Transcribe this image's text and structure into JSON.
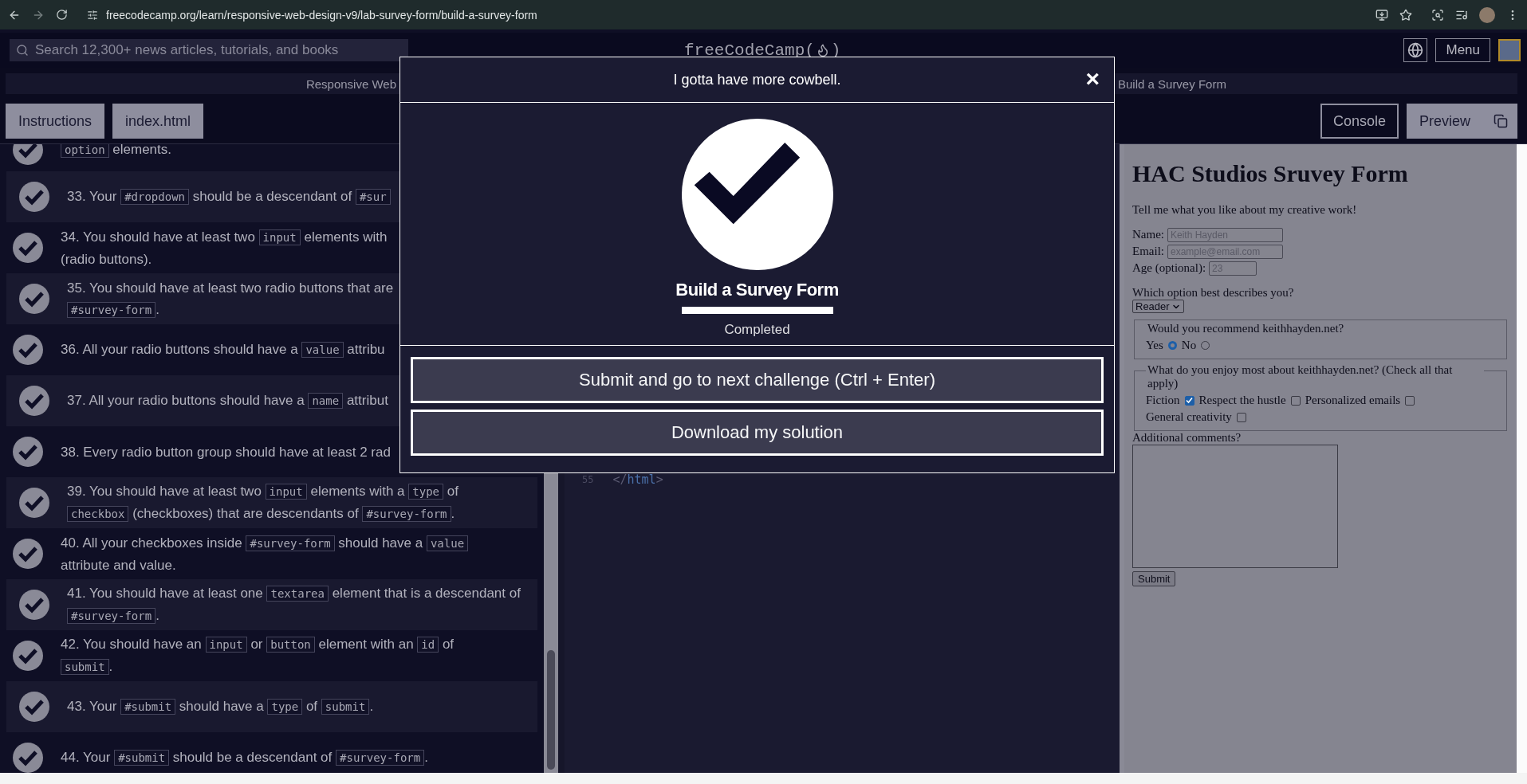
{
  "browser": {
    "url": "freecodecamp.org/learn/responsive-web-design-v9/lab-survey-form/build-a-survey-form"
  },
  "nav": {
    "search_placeholder": "Search 12,300+ news articles, tutorials, and books",
    "logo_before": "freeCodeCamp(",
    "logo_after": ")",
    "menu": "Menu"
  },
  "breadcrumbs": [
    "Responsive Web",
    "Build a Survey Form"
  ],
  "tabs_left": [
    {
      "label": "Instructions",
      "selected": true
    },
    {
      "label": "index.html",
      "selected": true
    }
  ],
  "tabs_right": [
    {
      "label": "Console",
      "selected": false
    },
    {
      "label": "Preview",
      "selected": true
    }
  ],
  "tests": [
    {
      "passed": true,
      "lines": [
        [
          {
            "kind": "code",
            "text": "option"
          },
          {
            "kind": "text",
            "text": " elements."
          }
        ]
      ]
    },
    {
      "passed": true,
      "lines": [
        [
          {
            "kind": "text",
            "text": "33. Your "
          },
          {
            "kind": "code",
            "text": "#dropdown"
          },
          {
            "kind": "text",
            "text": " should be a descendant of "
          },
          {
            "kind": "code",
            "text": "#sur"
          }
        ]
      ]
    },
    {
      "passed": true,
      "lines": [
        [
          {
            "kind": "text",
            "text": "34. You should have at least two "
          },
          {
            "kind": "code",
            "text": "input"
          },
          {
            "kind": "text",
            "text": " elements with"
          }
        ],
        [
          {
            "kind": "text",
            "text": "(radio buttons)."
          }
        ]
      ]
    },
    {
      "passed": true,
      "lines": [
        [
          {
            "kind": "text",
            "text": "35. You should have at least two radio buttons that are"
          }
        ],
        [
          {
            "kind": "code",
            "text": "#survey-form"
          },
          {
            "kind": "text",
            "text": "."
          }
        ]
      ]
    },
    {
      "passed": true,
      "lines": [
        [
          {
            "kind": "text",
            "text": "36. All your radio buttons should have a "
          },
          {
            "kind": "code",
            "text": "value"
          },
          {
            "kind": "text",
            "text": " attribu"
          }
        ]
      ]
    },
    {
      "passed": true,
      "lines": [
        [
          {
            "kind": "text",
            "text": "37. All your radio buttons should have a "
          },
          {
            "kind": "code",
            "text": "name"
          },
          {
            "kind": "text",
            "text": " attribut"
          }
        ]
      ]
    },
    {
      "passed": true,
      "lines": [
        [
          {
            "kind": "text",
            "text": "38. Every radio button group should have at least 2 rad"
          }
        ]
      ]
    },
    {
      "passed": true,
      "lines": [
        [
          {
            "kind": "text",
            "text": "39. You should have at least two "
          },
          {
            "kind": "code",
            "text": "input"
          },
          {
            "kind": "text",
            "text": " elements with a "
          },
          {
            "kind": "code",
            "text": "type"
          },
          {
            "kind": "text",
            "text": " of"
          }
        ],
        [
          {
            "kind": "code",
            "text": "checkbox"
          },
          {
            "kind": "text",
            "text": " (checkboxes) that are descendants of "
          },
          {
            "kind": "code",
            "text": "#survey-form"
          },
          {
            "kind": "text",
            "text": "."
          }
        ]
      ]
    },
    {
      "passed": true,
      "lines": [
        [
          {
            "kind": "text",
            "text": "40. All your checkboxes inside "
          },
          {
            "kind": "code",
            "text": "#survey-form"
          },
          {
            "kind": "text",
            "text": " should have a "
          },
          {
            "kind": "code",
            "text": "value"
          }
        ],
        [
          {
            "kind": "text",
            "text": "attribute and value."
          }
        ]
      ]
    },
    {
      "passed": true,
      "lines": [
        [
          {
            "kind": "text",
            "text": "41. You should have at least one "
          },
          {
            "kind": "code",
            "text": "textarea"
          },
          {
            "kind": "text",
            "text": " element that is a descendant of"
          }
        ],
        [
          {
            "kind": "code",
            "text": "#survey-form"
          },
          {
            "kind": "text",
            "text": "."
          }
        ]
      ]
    },
    {
      "passed": true,
      "lines": [
        [
          {
            "kind": "text",
            "text": "42. You should have an "
          },
          {
            "kind": "code",
            "text": "input"
          },
          {
            "kind": "text",
            "text": " or "
          },
          {
            "kind": "code",
            "text": "button"
          },
          {
            "kind": "text",
            "text": " element with an "
          },
          {
            "kind": "code",
            "text": "id"
          },
          {
            "kind": "text",
            "text": " of"
          }
        ],
        [
          {
            "kind": "code",
            "text": "submit"
          },
          {
            "kind": "text",
            "text": "."
          }
        ]
      ]
    },
    {
      "passed": true,
      "lines": [
        [
          {
            "kind": "text",
            "text": "43. Your "
          },
          {
            "kind": "code",
            "text": "#submit"
          },
          {
            "kind": "text",
            "text": " should have a "
          },
          {
            "kind": "code",
            "text": "type"
          },
          {
            "kind": "text",
            "text": " of "
          },
          {
            "kind": "code",
            "text": "submit"
          },
          {
            "kind": "text",
            "text": "."
          }
        ]
      ]
    },
    {
      "passed": true,
      "lines": [
        [
          {
            "kind": "text",
            "text": "44. Your "
          },
          {
            "kind": "code",
            "text": "#submit"
          },
          {
            "kind": "text",
            "text": " should be a descendant of "
          },
          {
            "kind": "code",
            "text": "#survey-form"
          },
          {
            "kind": "text",
            "text": "."
          }
        ]
      ]
    }
  ],
  "editor": {
    "lines": [
      {
        "number": "55",
        "code": [
          {
            "kind": "punct",
            "text": "</"
          },
          {
            "kind": "tag",
            "text": "html"
          },
          {
            "kind": "punct",
            "text": ">"
          }
        ]
      }
    ]
  },
  "preview": {
    "heading": "HAC Studios Sruvey Form",
    "intro": "Tell me what you like about my creative work!",
    "fields": [
      {
        "label": "Name:",
        "placeholder": "Keith Hayden",
        "kind": "text"
      },
      {
        "label": "Email:",
        "placeholder": "example@email.com",
        "kind": "text"
      },
      {
        "label": "Age (optional):",
        "placeholder": "23",
        "kind": "number"
      }
    ],
    "select_label": "Which option best describes you?",
    "select_value": "Reader",
    "recommend": {
      "legend": "Would you recommend keithhayden.net?",
      "options": [
        {
          "label": "Yes",
          "selected": true
        },
        {
          "label": "No",
          "selected": false
        }
      ]
    },
    "enjoy": {
      "legend": "What do you enjoy most about keithhayden.net? (Check all that apply)",
      "options": [
        {
          "label": "Fiction",
          "checked": true
        },
        {
          "label": "Respect the hustle",
          "checked": false
        },
        {
          "label": "Personalized emails",
          "checked": false
        },
        {
          "label": "General creativity",
          "checked": false
        }
      ]
    },
    "comments_label": "Additional comments?",
    "submit": "Submit"
  },
  "modal": {
    "title": "I gotta have more cowbell.",
    "close": "×",
    "challenge": "Build a Survey Form",
    "level": 1,
    "status": "Completed",
    "buttons": [
      "Submit and go to next challenge (Ctrl + Enter)",
      "Download my solution"
    ]
  }
}
